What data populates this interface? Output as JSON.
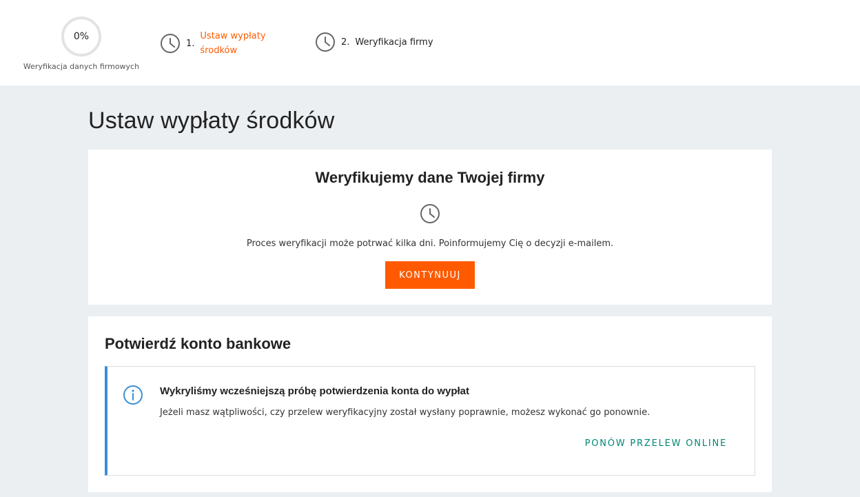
{
  "header": {
    "progress_value": "0%",
    "progress_fraction": 0,
    "progress_label": "Weryfikacja danych firmowych",
    "steps": [
      {
        "number": "1.",
        "label": "Ustaw wypłaty środków",
        "state": "active",
        "icon": "clock-icon"
      },
      {
        "number": "2.",
        "label": "Weryfikacja firmy",
        "state": "pending",
        "icon": "clock-icon"
      }
    ]
  },
  "page": {
    "title": "Ustaw wypłaty środków"
  },
  "verification": {
    "title": "Weryfikujemy dane Twojej firmy",
    "icon": "clock-icon",
    "text": "Proces weryfikacji może potrwać kilka dni. Poinformujemy Cię o decyzji e-mailem.",
    "button_label": "KONTYNUUJ"
  },
  "bank": {
    "title": "Potwierdź konto bankowe",
    "notice": {
      "icon": "info-icon",
      "title": "Wykryliśmy wcześniejszą próbę potwierdzenia konta do wypłat",
      "text": "Jeżeli masz wątpliwości, czy przelew weryfikacyjny został wysłany poprawnie, możesz wykonać go ponownie.",
      "link_label": "PONÓW PRZELEW ONLINE"
    }
  },
  "colors": {
    "accent": "#ff5a00",
    "link": "#008673",
    "info": "#3b8fd6",
    "background": "#ebeff2"
  }
}
